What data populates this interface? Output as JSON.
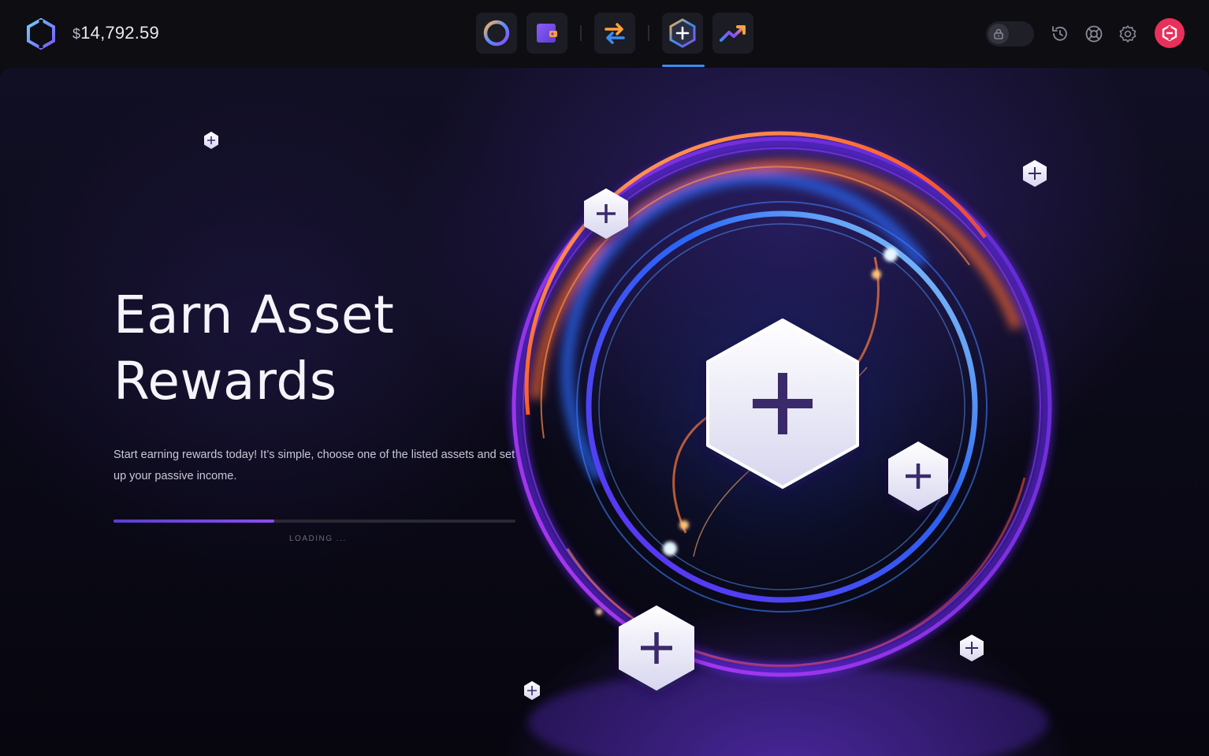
{
  "header": {
    "balance_currency": "$",
    "balance_amount": "14,792.59",
    "nav": [
      {
        "name": "portfolio",
        "icon": "portfolio-ring-icon"
      },
      {
        "name": "wallet",
        "icon": "wallet-icon"
      },
      {
        "name": "exchange",
        "icon": "exchange-arrows-icon"
      },
      {
        "name": "rewards",
        "icon": "rewards-hexagon-icon",
        "active": true
      },
      {
        "name": "trade",
        "icon": "trend-up-icon"
      }
    ],
    "right_icons": [
      "lock-icon",
      "history-icon",
      "support-lifebuoy-icon",
      "settings-gear-icon",
      "profile-logo-icon"
    ]
  },
  "main": {
    "title_line1": "Earn Asset",
    "title_line2": "Rewards",
    "description": "Start earning rewards today! It’s simple, choose one of the listed assets and set up your passive income.",
    "progress": 0.4,
    "loading_label": "LOADING ..."
  },
  "colors": {
    "accent_blue": "#3b8df0",
    "accent_purple": "#7a44e6",
    "brand_red": "#e8305a",
    "ring_orange": "#ff7a3c",
    "ring_blue": "#2b6bff",
    "ring_violet": "#9b3cff"
  }
}
